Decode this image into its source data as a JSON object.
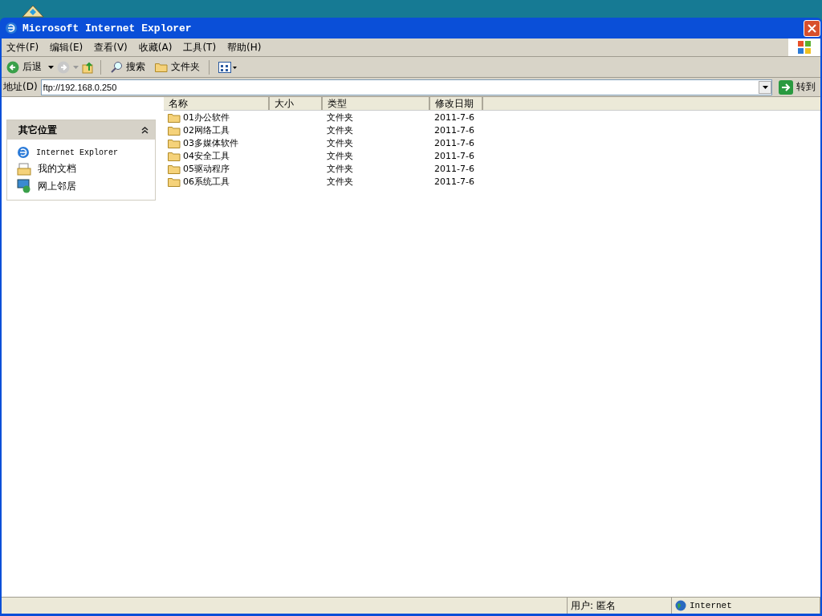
{
  "window": {
    "title": "Microsoft Internet Explorer"
  },
  "menu": [
    "文件(F)",
    "编辑(E)",
    "查看(V)",
    "收藏(A)",
    "工具(T)",
    "帮助(H)"
  ],
  "toolbar": {
    "back": "后退",
    "search": "搜索",
    "folders": "文件夹"
  },
  "address": {
    "label": "地址(D)",
    "value": "ftp://192.168.0.250",
    "go": "转到"
  },
  "sidebar": {
    "title": "其它位置",
    "expanded": true,
    "items": [
      {
        "kind": "ie",
        "label": "Internet Explorer"
      },
      {
        "kind": "docs",
        "label": "我的文档"
      },
      {
        "kind": "network",
        "label": "网上邻居"
      }
    ]
  },
  "table": {
    "columns": [
      "名称",
      "大小",
      "类型",
      "修改日期"
    ],
    "rows": [
      [
        "01办公软件",
        "",
        "文件夹",
        "2011-7-6"
      ],
      [
        "02网络工具",
        "",
        "文件夹",
        "2011-7-6"
      ],
      [
        "03多媒体软件",
        "",
        "文件夹",
        "2011-7-6"
      ],
      [
        "04安全工具",
        "",
        "文件夹",
        "2011-7-6"
      ],
      [
        "05驱动程序",
        "",
        "文件夹",
        "2011-7-6"
      ],
      [
        "06系统工具",
        "",
        "文件夹",
        "2011-7-6"
      ]
    ]
  },
  "status_bar": {
    "user": "用户: 匿名",
    "zone": "Internet"
  }
}
